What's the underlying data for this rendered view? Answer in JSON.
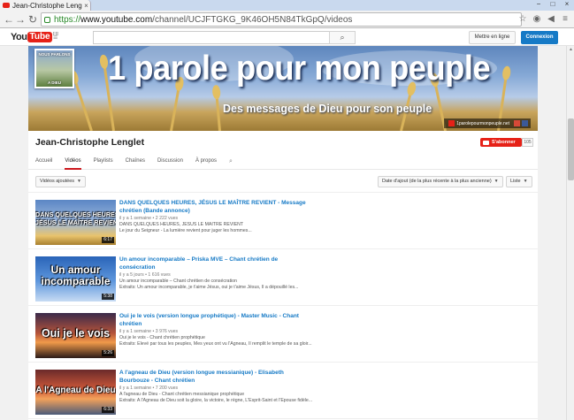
{
  "browser": {
    "tab_title": "Jean-Christophe Lenglet",
    "tab_close": "×",
    "url_prefix": "https://",
    "url_host": "www.youtube.com",
    "url_path": "/channel/UCJFTGKG_9K46OH5N84TkGpQ/videos",
    "window_controls": [
      "−",
      "□",
      "×"
    ]
  },
  "masthead": {
    "logo_you": "You",
    "logo_tube": "Tube",
    "logo_region": "FR",
    "guide": "≡",
    "search_placeholder": "",
    "search_icon": "⌕",
    "upload_label": "Mettre en ligne",
    "signin_label": "Connexion"
  },
  "banner": {
    "title": "1 parole pour mon peuple",
    "subtitle": "Des messages de Dieu pour son peuple",
    "link_text": "1parolepourmonpeuple.net",
    "avatar_top": "NOUS PARLONS",
    "avatar_bottom": "A DIEU"
  },
  "channel": {
    "name": "Jean-Christophe Lenglet",
    "subscribe_label": "S'abonner",
    "subscriber_count": "105",
    "tabs": [
      "Accueil",
      "Vidéos",
      "Playlists",
      "Chaînes",
      "Discussion",
      "À propos"
    ],
    "active_tab": "Vidéos"
  },
  "toolbar": {
    "filter_label": "Vidéos ajoutées",
    "sort_label": "Date d'ajout (de la plus récente à la plus ancienne)",
    "view_label": "Liste"
  },
  "videos": [
    {
      "thumb_text": "DANS QUELQUES HEURES, JÉSUS LE MAÎTRE REVIENT",
      "thumb_lines": [
        "DANS QUELQUES HEURES",
        "JÉSUS LE MAÎTRE REVIENT"
      ],
      "duration": "6:17",
      "title": "DANS QUELQUES HEURES, JÉSUS LE MAÎTRE REVIENT - Message chrétien (Bande annonce)",
      "meta": "il y a 1 semaine • 2 222 vues",
      "desc1": "DANS QUELQUES HEURES, JÉSUS LE MAÎTRE REVIENT",
      "desc2": "Le jour du Seigneur - La lumière revient pour juger les hommes..."
    },
    {
      "thumb_text": "Un amour incomparable",
      "thumb_lines": [
        "Un amour",
        "incomparable"
      ],
      "duration": "5:38",
      "title": "Un amour incomparable – Priska MVE – Chant chrétien de consécration",
      "meta": "il y a 5 jours • 1 616 vues",
      "desc1": "Un amour incomparable – Chant chrétien de consécration",
      "desc2": "Extraits: Un amour incomparable, je t'aime Jésus, oui je t'aime Jésus, Il a dépouillé les..."
    },
    {
      "thumb_text": "Oui je le vois",
      "thumb_lines": [
        "Oui je le vois"
      ],
      "duration": "5:26",
      "title": "Oui je le vois (version longue prophétique) - Master Music - Chant chrétien",
      "meta": "il y a 1 semaine • 3 976 vues",
      "desc1": "Oui je le vois - Chant chrétien prophétique",
      "desc2": "Extraits: Élevé par tous les peuples, Mes yeux ont vu l'Agneau, Il remplit le temple de sa gloir..."
    },
    {
      "thumb_text": "A l'Agneau de Dieu",
      "thumb_lines": [
        "A l'Agneau de Dieu"
      ],
      "duration": "6:33",
      "title": "A l'agneau de Dieu (version longue messianique) - Elisabeth Bourbouze - Chant chrétien",
      "meta": "il y a 1 semaine • 7 200 vues",
      "desc1": "A l'agneau de Dieu - Chant chrétien messianique prophétique",
      "desc2": "Extraits: A l'Agneau de Dieu soit la gloire, la victoire, le règne, L'Esprit-Saint et l'Épouse fidèle..."
    }
  ],
  "colors": {
    "youtube_red": "#e62117",
    "link_blue": "#167ac6",
    "signin_blue": "#167ac6"
  }
}
